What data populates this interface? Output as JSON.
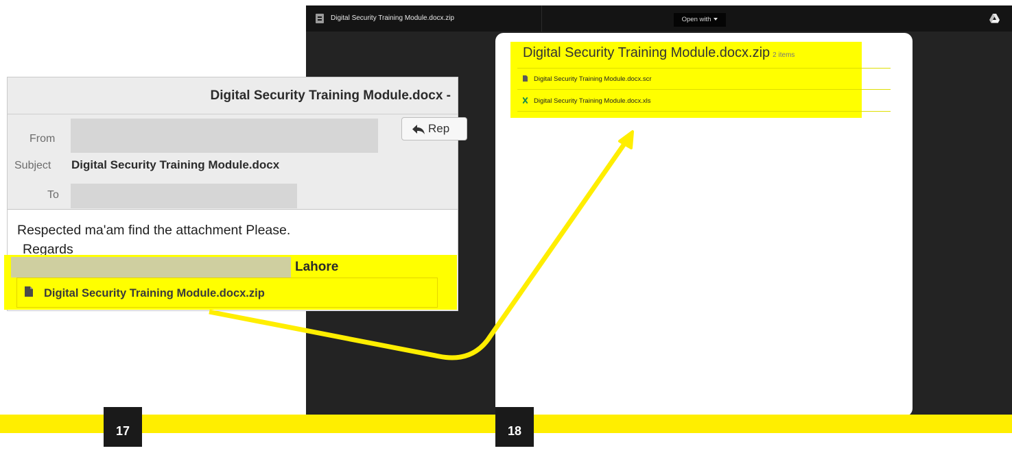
{
  "viewer": {
    "title": "Digital Security Training Module.docx.zip",
    "open_with_label": "Open with",
    "file_icon": "document-icon",
    "drive_icon": "google-drive-icon"
  },
  "zip_card": {
    "title": "Digital Security Training Module.docx.zip",
    "count": "2 items",
    "items": [
      {
        "name": "Digital Security Training Module.docx.scr",
        "icon": "document-icon"
      },
      {
        "name": "Digital Security Training Module.docx.xls",
        "icon": "excel-icon"
      }
    ]
  },
  "email": {
    "title": "Digital Security Training Module.docx -",
    "from_label": "From",
    "subject_label": "Subject",
    "subject_value": "Digital Security Training Module.docx",
    "to_label": "To",
    "reply_label": "Rep",
    "body_line1": "Respected ma'am find  the attachment Please.",
    "body_line2": "Regards",
    "signature_city": "Lahore",
    "attachment_name": "Digital Security Training Module.docx.zip"
  },
  "pages": {
    "left": "17",
    "right": "18"
  },
  "colors": {
    "highlight": "#ffff00",
    "bar": "#ffee00",
    "dark": "#232323",
    "arrow": "#ffee00"
  }
}
